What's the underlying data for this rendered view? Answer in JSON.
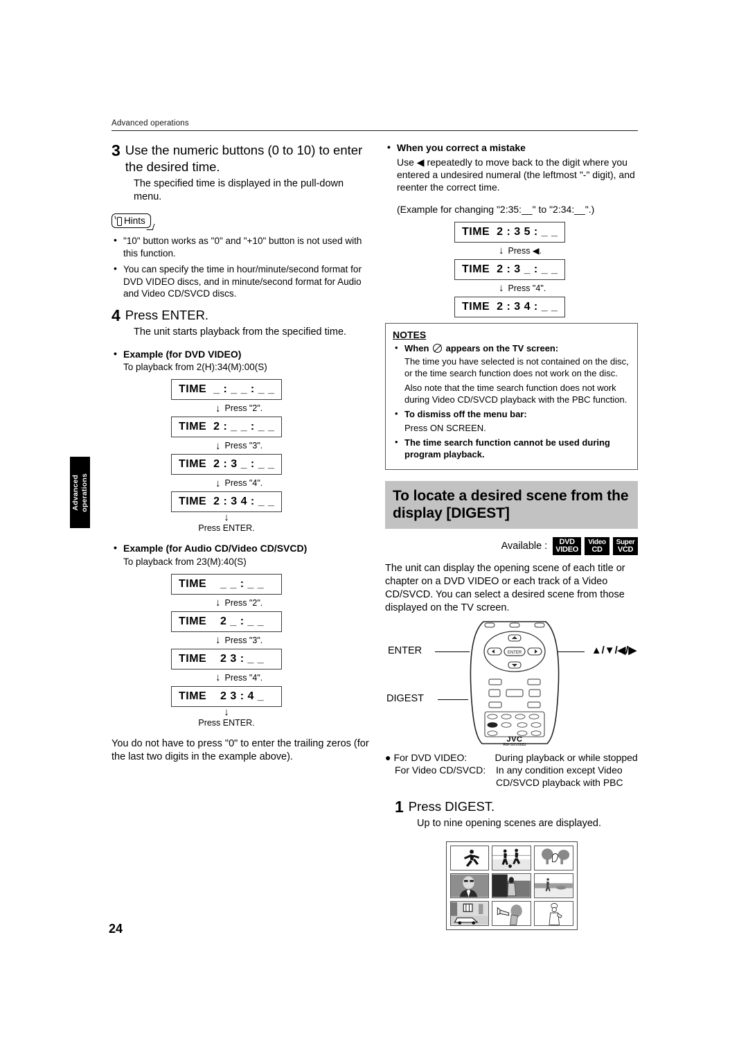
{
  "header": {
    "section": "Advanced operations"
  },
  "side_tab": {
    "line1": "Advanced",
    "line2": "operations"
  },
  "page_number": "24",
  "left_column": {
    "step3": {
      "number": "3",
      "title": "Use the numeric buttons (0 to 10) to enter the desired time.",
      "body": "The specified time is displayed in the pull-down menu."
    },
    "hints": {
      "label": "Hints",
      "items": [
        "\"10\" button works as \"0\" and \"+10\" button is not used with this function.",
        "You can specify the time in hour/minute/second format for DVD VIDEO discs, and in minute/second format for Audio and Video CD/SVCD discs."
      ]
    },
    "step4": {
      "number": "4",
      "title": "Press ENTER.",
      "body": "The unit starts playback from the specified time."
    },
    "example_dvd": {
      "heading": "Example (for DVD VIDEO)",
      "subtext": "To playback from 2(H):34(M):00(S)",
      "steps": [
        {
          "display": "TIME  _ : _ _ : _ _",
          "action": "Press \"2\"."
        },
        {
          "display": "TIME  2 : _ _ : _ _",
          "action": "Press \"3\"."
        },
        {
          "display": "TIME  2 : 3 _ : _ _",
          "action": "Press \"4\"."
        },
        {
          "display": "TIME  2 : 3 4 : _ _",
          "action": "Press ENTER."
        }
      ]
    },
    "example_cd": {
      "heading": "Example (for Audio CD/Video CD/SVCD)",
      "subtext": "To playback from 23(M):40(S)",
      "steps": [
        {
          "display": "TIME    _ _ : _ _",
          "action": "Press \"2\"."
        },
        {
          "display": "TIME    2 _ : _ _",
          "action": "Press \"3\"."
        },
        {
          "display": "TIME    2 3 : _ _",
          "action": "Press \"4\"."
        },
        {
          "display": "TIME    2 3 : 4 _",
          "action": "Press ENTER."
        }
      ]
    },
    "trailing_zeros_note": "You do not have to press \"0\" to enter the trailing zeros (for the last two digits in the example above)."
  },
  "right_column": {
    "correct_mistake": {
      "heading": "When you correct a mistake",
      "body": "Use ◀ repeatedly to move back to the digit where you entered a undesired numeral (the leftmost \"-\" digit), and reenter the correct time.",
      "example_caption": "(Example for changing \"2:35:__\" to \"2:34:__\".)",
      "steps": [
        {
          "display": "TIME  2 : 3 5 : _ _",
          "action": "Press ◀."
        },
        {
          "display": "TIME  2 : 3 _ : _ _",
          "action": "Press \"4\"."
        },
        {
          "display": "TIME  2 : 3 4 : _ _",
          "action": ""
        }
      ]
    },
    "notes": {
      "title": "NOTES",
      "items": [
        {
          "label": "When ⓧ appears on the TV screen:",
          "label_pre": "When",
          "label_post": "appears on the TV screen:",
          "has_symbol": true,
          "paragraphs": [
            "The time you have selected is not contained on the disc, or the time search function does not work on the disc.",
            "Also note that the time search function does not work during Video CD/SVCD playback with the PBC function."
          ]
        },
        {
          "label": "To dismiss off the menu bar:",
          "has_symbol": false,
          "paragraphs": [
            "Press ON SCREEN."
          ]
        },
        {
          "label": "The time search function cannot be used during program playback.",
          "has_symbol": false,
          "paragraphs": []
        }
      ]
    },
    "digest_section": {
      "banner_title": "To locate a desired scene from the display [DIGEST]",
      "available_label": "Available :",
      "badges": [
        {
          "top": "DVD",
          "bottom": "VIDEO"
        },
        {
          "top": "Video",
          "bottom": "CD"
        },
        {
          "top": "Super",
          "bottom": "VCD"
        }
      ],
      "intro": "The unit can display the opening scene of each title or chapter on a DVD VIDEO or each track of a Video CD/SVCD. You can select a desired scene from those displayed on the TV screen.",
      "remote": {
        "label_enter": "ENTER",
        "label_digest": "DIGEST",
        "label_arrows": "▲/▼/◀/▶",
        "brand": "JVC",
        "model": "RM-SXV008J",
        "model_sub": "REMOTE CONTROL"
      },
      "conditions": [
        {
          "term": "For DVD VIDEO:",
          "desc": "During playback or while stopped"
        },
        {
          "term": "For Video CD/SVCD:",
          "desc": "In any condition except Video CD/SVCD playback with PBC"
        }
      ],
      "step1": {
        "number": "1",
        "title": "Press DIGEST.",
        "body": "Up to nine opening scenes are displayed."
      }
    }
  },
  "colors": {
    "banner_gray": "#c2c2c2",
    "badge_black": "#000000",
    "rule": "#1a1a1a"
  }
}
